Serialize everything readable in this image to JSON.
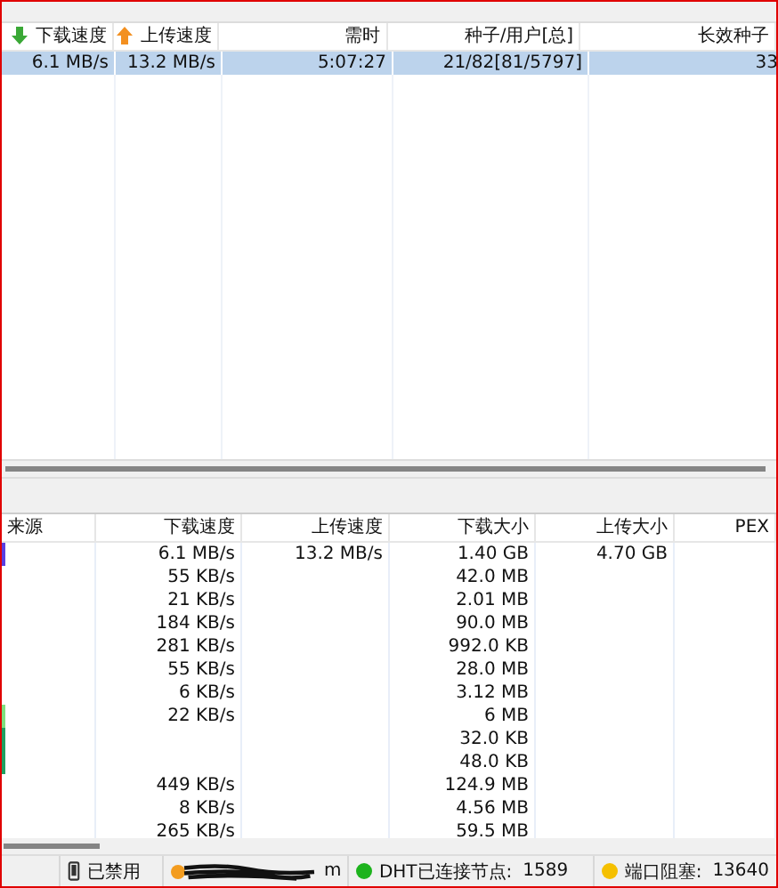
{
  "torrents": {
    "columns": [
      "下载速度",
      "上传速度",
      "需时",
      "种子/用户[总]",
      "长效种子"
    ],
    "rows": [
      {
        "selected": true,
        "cells": [
          "6.1 MB/s",
          "13.2 MB/s",
          "5:07:27",
          "21/82[81/5797]",
          "33"
        ]
      }
    ]
  },
  "peers": {
    "columns": [
      "来源",
      "下载速度",
      "上传速度",
      "下载大小",
      "上传大小",
      "PEX"
    ],
    "rows": [
      {
        "color": "#5a3ee0",
        "cells": [
          "",
          "6.1 MB/s",
          "13.2 MB/s",
          "1.40 GB",
          "4.70 GB",
          ""
        ]
      },
      {
        "cells": [
          "",
          "55 KB/s",
          "",
          "42.0 MB",
          "",
          ""
        ]
      },
      {
        "cells": [
          "",
          "21 KB/s",
          "",
          "2.01 MB",
          "",
          ""
        ]
      },
      {
        "cells": [
          "",
          "184 KB/s",
          "",
          "90.0 MB",
          "",
          ""
        ]
      },
      {
        "cells": [
          "",
          "281 KB/s",
          "",
          "992.0 KB",
          "",
          ""
        ]
      },
      {
        "cells": [
          "",
          "55 KB/s",
          "",
          "28.0 MB",
          "",
          ""
        ]
      },
      {
        "cells": [
          "",
          "6 KB/s",
          "",
          "3.12 MB",
          "",
          ""
        ]
      },
      {
        "color": "#7ee07e",
        "cells": [
          "",
          "22 KB/s",
          "",
          "6 MB",
          "",
          ""
        ]
      },
      {
        "color": "#1fa060",
        "cells": [
          "",
          "",
          "",
          "32.0 KB",
          "",
          ""
        ]
      },
      {
        "color": "#1fa060",
        "cells": [
          "",
          "",
          "",
          "48.0 KB",
          "",
          ""
        ]
      },
      {
        "cells": [
          "",
          "449 KB/s",
          "",
          "124.9 MB",
          "",
          ""
        ]
      },
      {
        "cells": [
          "",
          "8 KB/s",
          "",
          "4.56 MB",
          "",
          ""
        ]
      },
      {
        "cells": [
          "",
          "265 KB/s",
          "",
          "59.5 MB",
          "",
          ""
        ]
      }
    ]
  },
  "status_bar": [
    {
      "kind": "blank"
    },
    {
      "kind": "phone",
      "label": "已禁用"
    },
    {
      "kind": "redacted",
      "label": "m",
      "color": "#f39c1f"
    },
    {
      "kind": "dot",
      "color": "#1db31d",
      "label": "DHT已连接节点:",
      "value": "1589"
    },
    {
      "kind": "dot",
      "color": "#f5c000",
      "label": "端口阻塞:",
      "value": "13640"
    }
  ]
}
